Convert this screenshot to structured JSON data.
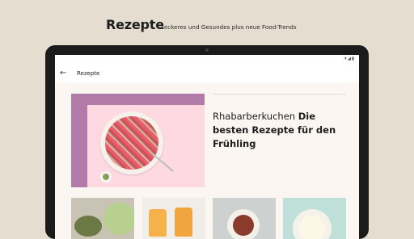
{
  "promo": {
    "title": "Rezepte",
    "subtitle": "Leckeres und Gesundes plus neue Food-Trends"
  },
  "statusbar": {
    "time": "",
    "icons": "▾◢▮"
  },
  "toolbar": {
    "back_icon": "arrow-left-icon",
    "back_glyph": "←",
    "title": "Rezepte"
  },
  "featured_article": {
    "title": "Rhabarberkuchen",
    "description": "Die besten Rezepte für den Frühling"
  },
  "recipe_cards": [
    {
      "image": "vegetable-noodles"
    },
    {
      "image": "orange-drinks"
    },
    {
      "image": "salad-bowl"
    },
    {
      "image": "creamy-soup"
    }
  ],
  "colors": {
    "background": "#e5ddd0",
    "hero_stripe": "#b27aa6",
    "hero_bg": "#ffd9e2"
  }
}
